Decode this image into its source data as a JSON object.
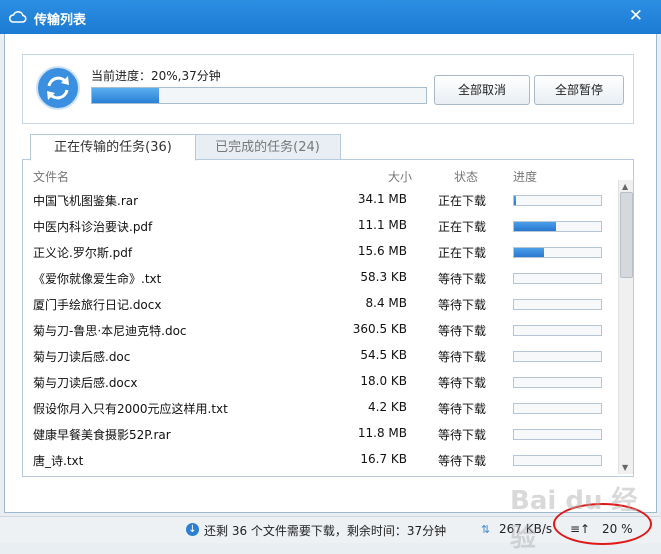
{
  "window": {
    "title": "传输列表",
    "close_glyph": "✕"
  },
  "progress": {
    "label": "当前进度：20%,37分钟",
    "fraction": 0.2,
    "cancel_all": "全部取消",
    "pause_all": "全部暂停"
  },
  "tabs": [
    {
      "label": "正在传输的任务(36)",
      "active": true
    },
    {
      "label": "已完成的任务(24)",
      "active": false
    }
  ],
  "columns": {
    "name": "文件名",
    "size": "大小",
    "status": "状态",
    "progress": "进度"
  },
  "files": [
    {
      "name": "中国飞机图鉴集.rar",
      "size": "34.1 MB",
      "status": "正在下载",
      "progress": 0.02
    },
    {
      "name": "中医内科诊治要诀.pdf",
      "size": "11.1 MB",
      "status": "正在下载",
      "progress": 0.48
    },
    {
      "name": "正义论.罗尔斯.pdf",
      "size": "15.6 MB",
      "status": "正在下载",
      "progress": 0.35
    },
    {
      "name": "《爱你就像爱生命》.txt",
      "size": "58.3 KB",
      "status": "等待下载",
      "progress": 0
    },
    {
      "name": "厦门手绘旅行日记.docx",
      "size": "8.4 MB",
      "status": "等待下载",
      "progress": 0
    },
    {
      "name": "菊与刀-鲁思·本尼迪克特.doc",
      "size": "360.5 KB",
      "status": "等待下载",
      "progress": 0
    },
    {
      "name": "菊与刀读后感.doc",
      "size": "54.5 KB",
      "status": "等待下载",
      "progress": 0
    },
    {
      "name": "菊与刀读后感.docx",
      "size": "18.0 KB",
      "status": "等待下载",
      "progress": 0
    },
    {
      "name": "假设你月入只有2000元应这样用.txt",
      "size": "4.2 KB",
      "status": "等待下载",
      "progress": 0
    },
    {
      "name": "健康早餐美食摄影52P.rar",
      "size": "11.8 MB",
      "status": "等待下载",
      "progress": 0
    },
    {
      "name": "唐_诗.txt",
      "size": "16.7 KB",
      "status": "等待下载",
      "progress": 0
    }
  ],
  "statusbar": {
    "remaining_text": "还剩 36 个文件需要下载，剩余时间：37分钟",
    "speed": "267 KB/s",
    "percent": "20 %"
  },
  "watermark": "Baidu 经验",
  "colors": {
    "accent": "#1c7ad3",
    "highlight": "#e01818"
  }
}
